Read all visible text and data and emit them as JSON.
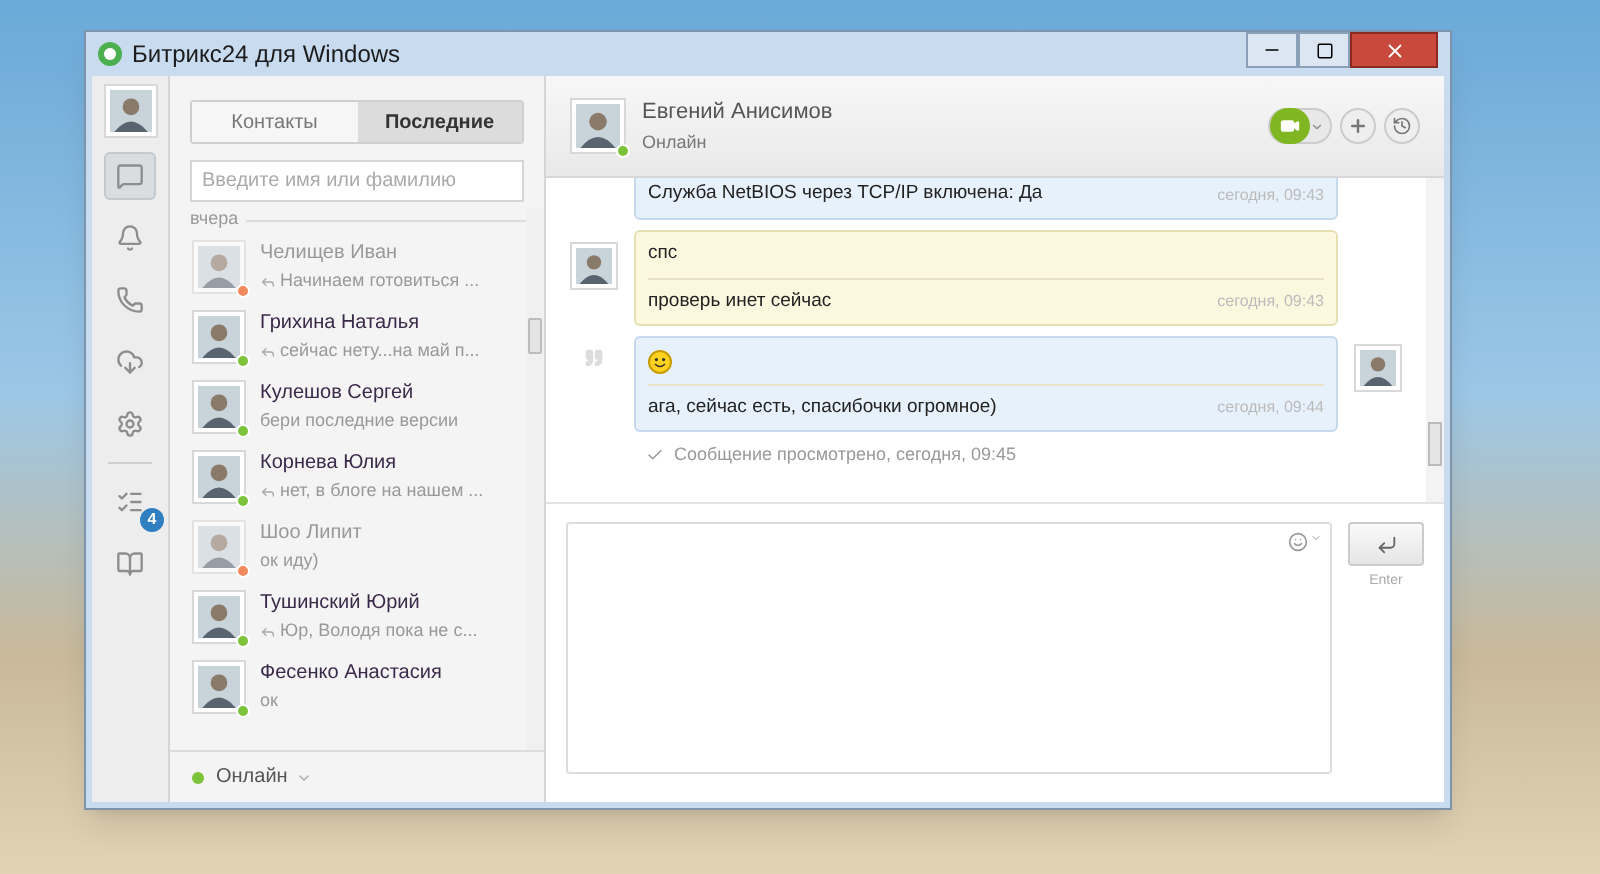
{
  "window": {
    "title": "Битрикс24 для Windows"
  },
  "rail": {
    "items": [
      {
        "kind": "chat",
        "selected": true
      },
      {
        "kind": "bell",
        "selected": false
      },
      {
        "kind": "phone",
        "selected": false
      },
      {
        "kind": "disk",
        "selected": false
      },
      {
        "kind": "gear",
        "selected": false
      },
      {
        "kind": "list",
        "selected": false,
        "badge": "4"
      },
      {
        "kind": "book",
        "selected": false
      }
    ]
  },
  "contacts": {
    "tabs": [
      {
        "label": "Контакты",
        "selected": false
      },
      {
        "label": "Последние",
        "selected": true
      }
    ],
    "search": {
      "placeholder": "Введите имя или фамилию"
    },
    "group_label": "вчера",
    "items": [
      {
        "name": "Челищев Иван",
        "preview": "Начинаем готовиться ...",
        "replied": true,
        "dimmed": true,
        "color": "#f08a5d"
      },
      {
        "name": "Грихина Наталья",
        "preview": "сейчас нету...на май п...",
        "replied": true,
        "dimmed": false,
        "color": "#7cc23a"
      },
      {
        "name": "Кулешов Сергей",
        "preview": "бери последние версии",
        "replied": false,
        "dimmed": false,
        "color": "#7cc23a"
      },
      {
        "name": "Корнева Юлия",
        "preview": "нет, в блоге на нашем ...",
        "replied": true,
        "dimmed": false,
        "color": "#7cc23a"
      },
      {
        "name": "Шоо Липит",
        "preview": "ок иду)",
        "replied": false,
        "dimmed": true,
        "color": "#f08a5d"
      },
      {
        "name": "Тушинский Юрий",
        "preview": "Юр, Володя пока не с...",
        "replied": true,
        "dimmed": false,
        "color": "#7cc23a"
      },
      {
        "name": "Фесенко Анастасия",
        "preview": "ок",
        "replied": false,
        "dimmed": false,
        "color": "#7cc23a"
      }
    ],
    "status": {
      "label": "Онлайн",
      "color": "#7cc23a"
    }
  },
  "chat": {
    "name": "Евгений Анисимов",
    "status": "Онлайн",
    "color": "#7cc23a",
    "messages": [
      {
        "outgoing": true,
        "lines": [
          {
            "kind": "text",
            "text": "Служба NetBIOS через TCP/IP включена: Да",
            "time": "сегодня, 09:43"
          }
        ]
      },
      {
        "outgoing": false,
        "lines": [
          {
            "kind": "text",
            "text": "спс"
          },
          {
            "kind": "text",
            "text": "проверь инет сейчас",
            "time": "сегодня, 09:43"
          }
        ]
      },
      {
        "outgoing": true,
        "quoted": true,
        "lines": [
          {
            "kind": "emoji"
          },
          {
            "kind": "text",
            "text": "ага, сейчас есть, спасибочки огромное)",
            "time": "сегодня, 09:44"
          }
        ]
      }
    ],
    "seen": "Сообщение просмотрено, сегодня, 09:45",
    "send_hint": "Enter"
  }
}
